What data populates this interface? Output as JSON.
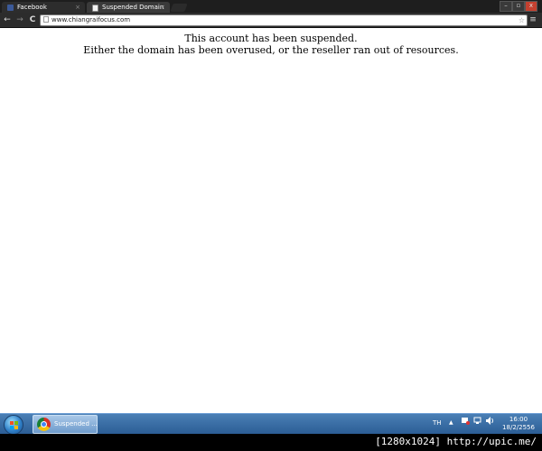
{
  "browser": {
    "tabs": [
      {
        "label": "Facebook",
        "icon": "facebook-icon"
      },
      {
        "label": "Suspended Domain",
        "icon": "page-icon"
      }
    ],
    "tab_close": "×",
    "window_controls": {
      "minimize": "–",
      "maximize": "▫",
      "close": "x"
    },
    "nav": {
      "back": "←",
      "forward": "→",
      "reload": "C"
    },
    "url": "www.chiangraifocus.com",
    "star": "☆",
    "menu": "≡"
  },
  "page": {
    "line1": "This account has been suspended.",
    "line2": "Either the domain has been overused, or the reseller ran out of resources."
  },
  "taskbar": {
    "task_label": "Suspended ...",
    "language": "TH",
    "tray_up": "▲",
    "time": "16:00",
    "date": "18/2/2556"
  },
  "watermark": "[1280x1024] http://upic.me/",
  "colors": {
    "facebook": "#3b5998",
    "taskbar": "#2a5c94",
    "close_button": "#c4402f"
  }
}
